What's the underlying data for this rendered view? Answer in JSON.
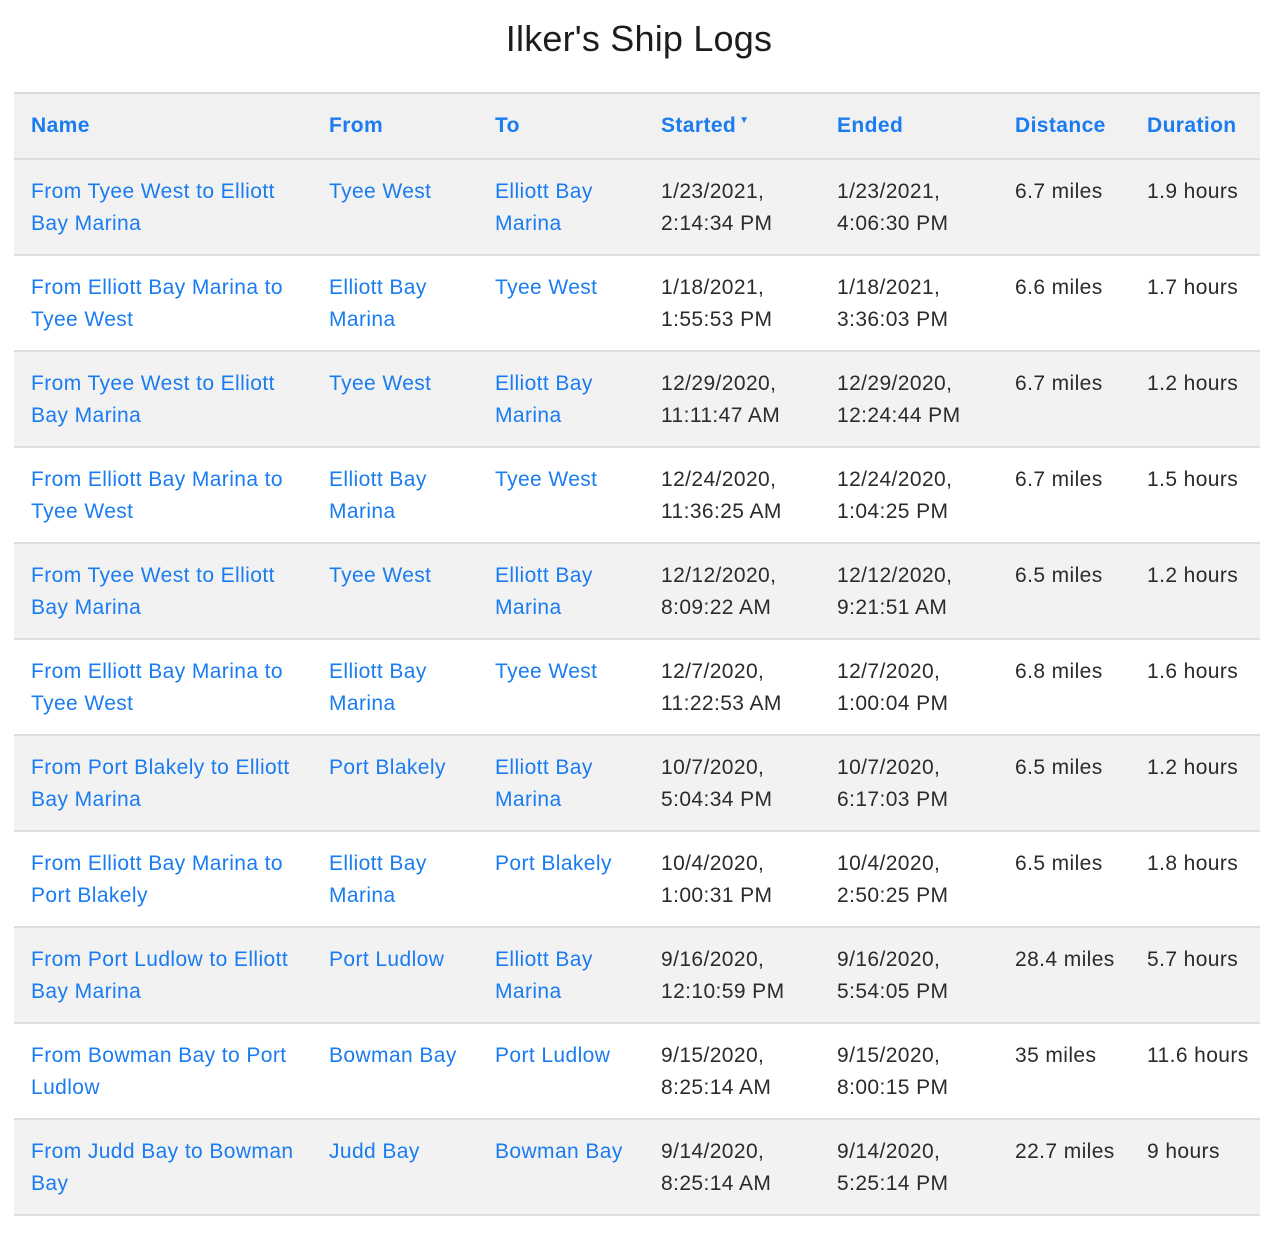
{
  "page": {
    "title": "Ilker's Ship Logs"
  },
  "table": {
    "columns": [
      {
        "label": "Name"
      },
      {
        "label": "From"
      },
      {
        "label": "To"
      },
      {
        "label": "Started",
        "sort": "▼"
      },
      {
        "label": "Ended"
      },
      {
        "label": "Distance"
      },
      {
        "label": "Duration"
      }
    ],
    "rows": [
      {
        "name": "From Tyee West to Elliott Bay Marina",
        "from": "Tyee West",
        "to": "Elliott Bay Marina",
        "started": "1/23/2021, 2:14:34 PM",
        "ended": "1/23/2021, 4:06:30 PM",
        "distance": "6.7 miles",
        "duration": "1.9 hours"
      },
      {
        "name": "From Elliott Bay Marina to Tyee West",
        "from": "Elliott Bay Marina",
        "to": "Tyee West",
        "started": "1/18/2021, 1:55:53 PM",
        "ended": "1/18/2021, 3:36:03 PM",
        "distance": "6.6 miles",
        "duration": "1.7 hours"
      },
      {
        "name": "From Tyee West to Elliott Bay Marina",
        "from": "Tyee West",
        "to": "Elliott Bay Marina",
        "started": "12/29/2020, 11:11:47 AM",
        "ended": "12/29/2020, 12:24:44 PM",
        "distance": "6.7 miles",
        "duration": "1.2 hours"
      },
      {
        "name": "From Elliott Bay Marina to Tyee West",
        "from": "Elliott Bay Marina",
        "to": "Tyee West",
        "started": "12/24/2020, 11:36:25 AM",
        "ended": "12/24/2020, 1:04:25 PM",
        "distance": "6.7 miles",
        "duration": "1.5 hours"
      },
      {
        "name": "From Tyee West to Elliott Bay Marina",
        "from": "Tyee West",
        "to": "Elliott Bay Marina",
        "started": "12/12/2020, 8:09:22 AM",
        "ended": "12/12/2020, 9:21:51 AM",
        "distance": "6.5 miles",
        "duration": "1.2 hours"
      },
      {
        "name": "From Elliott Bay Marina to Tyee West",
        "from": "Elliott Bay Marina",
        "to": "Tyee West",
        "started": "12/7/2020, 11:22:53 AM",
        "ended": "12/7/2020, 1:00:04 PM",
        "distance": "6.8 miles",
        "duration": "1.6 hours"
      },
      {
        "name": "From Port Blakely to Elliott Bay Marina",
        "from": "Port Blakely",
        "to": "Elliott Bay Marina",
        "started": "10/7/2020, 5:04:34 PM",
        "ended": "10/7/2020, 6:17:03 PM",
        "distance": "6.5 miles",
        "duration": "1.2 hours"
      },
      {
        "name": "From Elliott Bay Marina to Port Blakely",
        "from": "Elliott Bay Marina",
        "to": "Port Blakely",
        "started": "10/4/2020, 1:00:31 PM",
        "ended": "10/4/2020, 2:50:25 PM",
        "distance": "6.5 miles",
        "duration": "1.8 hours"
      },
      {
        "name": "From Port Ludlow to Elliott Bay Marina",
        "from": "Port Ludlow",
        "to": "Elliott Bay Marina",
        "started": "9/16/2020, 12:10:59 PM",
        "ended": "9/16/2020, 5:54:05 PM",
        "distance": "28.4 miles",
        "duration": "5.7 hours"
      },
      {
        "name": "From Bowman Bay to Port Ludlow",
        "from": "Bowman Bay",
        "to": "Port Ludlow",
        "started": "9/15/2020, 8:25:14 AM",
        "ended": "9/15/2020, 8:00:15 PM",
        "distance": "35 miles",
        "duration": "11.6 hours"
      },
      {
        "name": "From Judd Bay to Bowman Bay",
        "from": "Judd Bay",
        "to": "Bowman Bay",
        "started": "9/14/2020, 8:25:14 AM",
        "ended": "9/14/2020, 5:25:14 PM",
        "distance": "22.7 miles",
        "duration": "9 hours"
      }
    ]
  }
}
